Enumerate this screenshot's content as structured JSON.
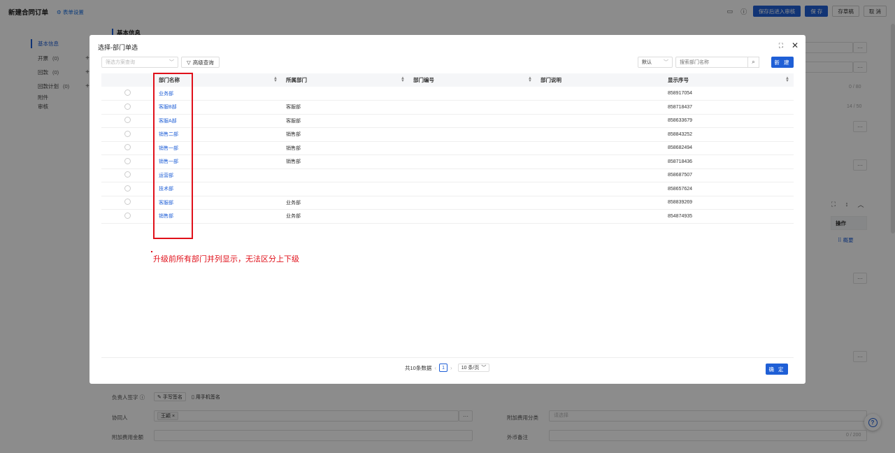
{
  "page": {
    "title": "新建合同订单",
    "form_settings": "表单设置",
    "actions": {
      "save_submit": "保存后进入审核",
      "save": "保 存",
      "draft": "存草稿",
      "cancel": "取 消"
    },
    "icons": {
      "monitor": "monitor-icon",
      "info": "info-icon",
      "settings": "gear-icon"
    }
  },
  "sidebar": {
    "items": [
      {
        "label": "基本信息",
        "count": "",
        "plus": false,
        "active": true
      },
      {
        "label": "开票",
        "count": "(0)",
        "plus": true
      },
      {
        "label": "回款",
        "count": "(0)",
        "plus": true
      },
      {
        "label": "回款计划",
        "count": "(0)",
        "plus": true
      },
      {
        "label": "附件",
        "count": "",
        "plus": false
      },
      {
        "label": "审核",
        "count": "",
        "plus": false
      }
    ]
  },
  "main": {
    "section_title": "基本信息",
    "counter_1": "0 / 80",
    "counter_2": "14 / 50",
    "counter_3": "0 / 200",
    "ops_header": "操作",
    "ops_link": "概要",
    "signature_label": "负责人签字",
    "handwrite": "手写签名",
    "phone_sign": "用手机签名",
    "collaborator_label": "协同人",
    "collaborator_tag": "王颖",
    "extra_fee_category_label": "附加费用分类",
    "extra_fee_category_placeholder": "请选择",
    "extra_fee_amount_label": "附加费用金额",
    "foreign_note_label": "外币备注"
  },
  "modal": {
    "title": "选择-部门单选",
    "scheme_placeholder": "筛选方案查询",
    "advanced_query": "高级查询",
    "default_option": "默认",
    "search_placeholder": "搜索部门名称",
    "new_button": "新 建",
    "columns": [
      "部门名称",
      "所属部门",
      "部门编号",
      "部门说明",
      "显示序号"
    ],
    "rows": [
      {
        "name": "业务部",
        "parent": "",
        "code": "",
        "desc": "",
        "seq": "858917054"
      },
      {
        "name": "客服B部",
        "parent": "客服部",
        "code": "",
        "desc": "",
        "seq": "858718437"
      },
      {
        "name": "客服A部",
        "parent": "客服部",
        "code": "",
        "desc": "",
        "seq": "858633679"
      },
      {
        "name": "销售二部",
        "parent": "销售部",
        "code": "",
        "desc": "",
        "seq": "858843252"
      },
      {
        "name": "销售一部",
        "parent": "销售部",
        "code": "",
        "desc": "",
        "seq": "858682494"
      },
      {
        "name": "销售一部",
        "parent": "销售部",
        "code": "",
        "desc": "",
        "seq": "858718436"
      },
      {
        "name": "运营部",
        "parent": "",
        "code": "",
        "desc": "",
        "seq": "858687507"
      },
      {
        "name": "技术部",
        "parent": "",
        "code": "",
        "desc": "",
        "seq": "858657624"
      },
      {
        "name": "客服部",
        "parent": "业务部",
        "code": "",
        "desc": "",
        "seq": "858839269"
      },
      {
        "name": "销售部",
        "parent": "业务部",
        "code": "",
        "desc": "",
        "seq": "854874935"
      }
    ],
    "annotation": "升级前所有部门并列显示，无法区分上下级",
    "pagination": {
      "total_text": "共10条数据",
      "current_page": "1",
      "page_size": "10 条/页"
    },
    "confirm_button": "确 定"
  },
  "colors": {
    "primary": "#1f5fd6",
    "annotation_red": "#e0101a",
    "overlay": "rgba(0,0,0,0.45)"
  }
}
